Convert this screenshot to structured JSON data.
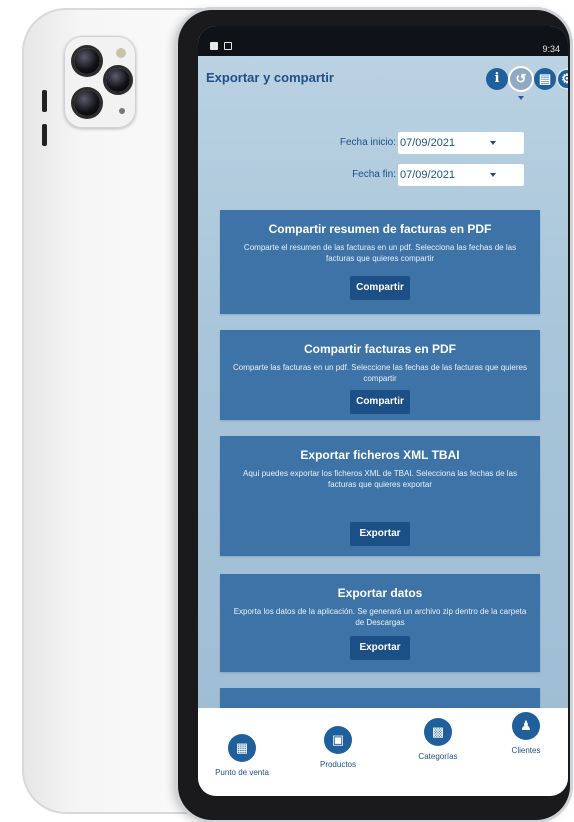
{
  "status_bar": {
    "time": "9:34"
  },
  "header": {
    "title": "Exportar y compartir",
    "icons": [
      "info-icon",
      "share-icon",
      "document-icon",
      "settings-icon"
    ],
    "info_glyph": "i"
  },
  "filters": {
    "start_label": "Fecha inicio:",
    "start_value": "07/09/2021",
    "end_label": "Fecha fin:",
    "end_value": "07/09/2021"
  },
  "cards": [
    {
      "title": "Compartir resumen de facturas en PDF",
      "description": "Comparte el resumen de las facturas en un pdf. Selecciona las fechas de las facturas que quieres compartir",
      "button": "Compartir"
    },
    {
      "title": "Compartir facturas en PDF",
      "description": "Comparte las facturas en un pdf. Seleccione las fechas de las facturas que quieres compartir",
      "button": "Compartir"
    },
    {
      "title": "Exportar ficheros XML TBAI",
      "description": "Aquí puedes exportar los ficheros XML de TBAI. Selecciona las fechas de las facturas que quieres exportar",
      "button": "Exportar"
    },
    {
      "title": "Exportar datos",
      "description": "Exporta los datos de la aplicación. Se generará un archivo zip dentro de la carpeta de Descargas",
      "button": "Exportar"
    }
  ],
  "bottom_nav": [
    {
      "label": "Punto de venta",
      "icon": "register-icon"
    },
    {
      "label": "Productos",
      "icon": "box-icon"
    },
    {
      "label": "Categorías",
      "icon": "grid-icon"
    },
    {
      "label": "Clientes",
      "icon": "users-icon"
    }
  ],
  "colors": {
    "primary": "#1f5f9c",
    "card": "#3d73a7",
    "background": "#b2cadd"
  }
}
